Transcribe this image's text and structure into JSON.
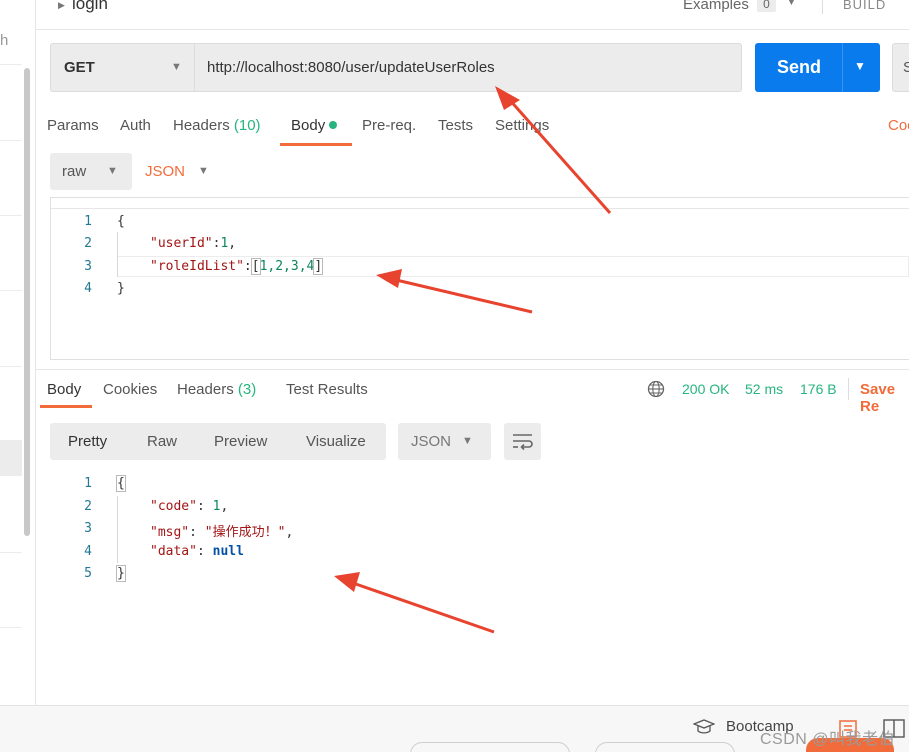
{
  "sidebar": {
    "cut_text": "h"
  },
  "topbar": {
    "request_name": "login",
    "examples_label": "Examples",
    "examples_count": "0",
    "build_label": "BUILD"
  },
  "request": {
    "method": "GET",
    "url": "http://localhost:8080/user/updateUserRoles",
    "send_label": "Send",
    "save_stub": "S",
    "tabs": [
      {
        "label": "Params",
        "count": ""
      },
      {
        "label": "Auth",
        "count": ""
      },
      {
        "label": "Headers",
        "count": "(10)"
      },
      {
        "label": "Body",
        "count": ""
      },
      {
        "label": "Pre-req.",
        "count": ""
      },
      {
        "label": "Tests",
        "count": ""
      },
      {
        "label": "Settings",
        "count": ""
      }
    ],
    "active_tab": "Body",
    "cookies_cut": "Coo",
    "body_mode": "raw",
    "body_format": "JSON",
    "body_lines": [
      {
        "num": "1",
        "text": "{"
      },
      {
        "num": "2",
        "key": "\"userId\"",
        "sep": ":",
        "value": "1",
        "tail": ","
      },
      {
        "num": "3",
        "key": "\"roleIdList\"",
        "sep": ":",
        "value": "1,2,3,4"
      },
      {
        "num": "4",
        "text": "}"
      }
    ]
  },
  "response": {
    "tabs": [
      {
        "label": "Body",
        "count": ""
      },
      {
        "label": "Cookies",
        "count": ""
      },
      {
        "label": "Headers",
        "count": "(3)"
      },
      {
        "label": "Test Results",
        "count": ""
      }
    ],
    "active_tab": "Body",
    "status": "200 OK",
    "time": "52 ms",
    "size": "176 B",
    "save_label": "Save Re",
    "view_modes": [
      "Pretty",
      "Raw",
      "Preview",
      "Visualize"
    ],
    "active_view": "Pretty",
    "format": "JSON",
    "body_lines": [
      {
        "num": "1",
        "text": "{"
      },
      {
        "num": "2",
        "key": "\"code\"",
        "sep": ": ",
        "value": "1",
        "tail": ","
      },
      {
        "num": "3",
        "key": "\"msg\"",
        "sep": ": ",
        "value": "\"操作成功！\"",
        "tail": ","
      },
      {
        "num": "4",
        "key": "\"data\"",
        "sep": ": ",
        "value": "null"
      },
      {
        "num": "5",
        "text": "}"
      }
    ]
  },
  "footer": {
    "bootcamp_label": "Bootcamp",
    "watermark": "CSDN @叫我老伯"
  },
  "colors": {
    "accent": "#f26b3a",
    "send": "#097bed",
    "success": "#26b47f",
    "arrow": "#e8432e"
  }
}
